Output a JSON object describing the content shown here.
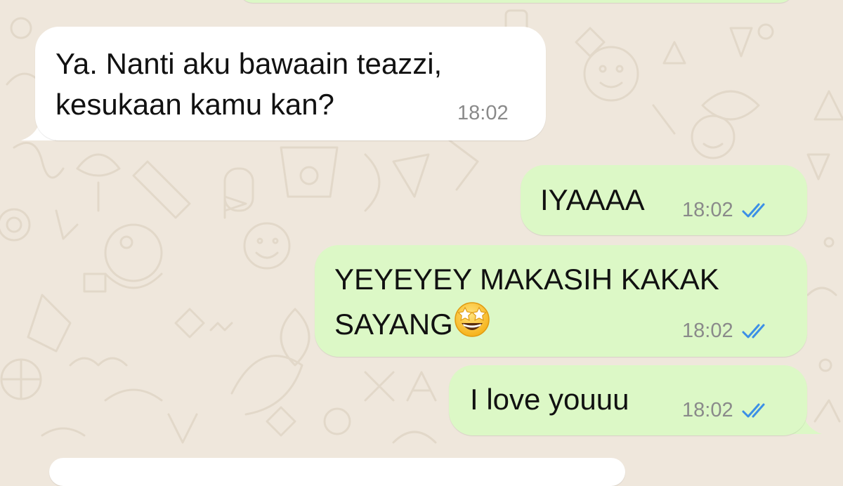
{
  "chat": {
    "messages": [
      {
        "direction": "incoming",
        "lines": [
          "Ya. Nanti aku bawaain teazzi,",
          "kesukaan kamu kan?"
        ],
        "time": "18:02"
      },
      {
        "direction": "outgoing",
        "lines": [
          "IYAAAA"
        ],
        "time": "18:02",
        "status": "read"
      },
      {
        "direction": "outgoing",
        "lines": [
          "YEYEYEY MAKASIH KAKAK",
          "SAYANG"
        ],
        "emoji": "star-struck-emoji",
        "time": "18:02",
        "status": "read"
      },
      {
        "direction": "outgoing",
        "lines": [
          "I love youuu"
        ],
        "time": "18:02",
        "status": "read"
      }
    ]
  },
  "colors": {
    "wallpaper": "#efe7dc",
    "incoming_bubble": "#ffffff",
    "outgoing_bubble": "#dcf8c6",
    "read_ticks": "#3b8fe6",
    "timestamp": "#8a8a8a"
  }
}
